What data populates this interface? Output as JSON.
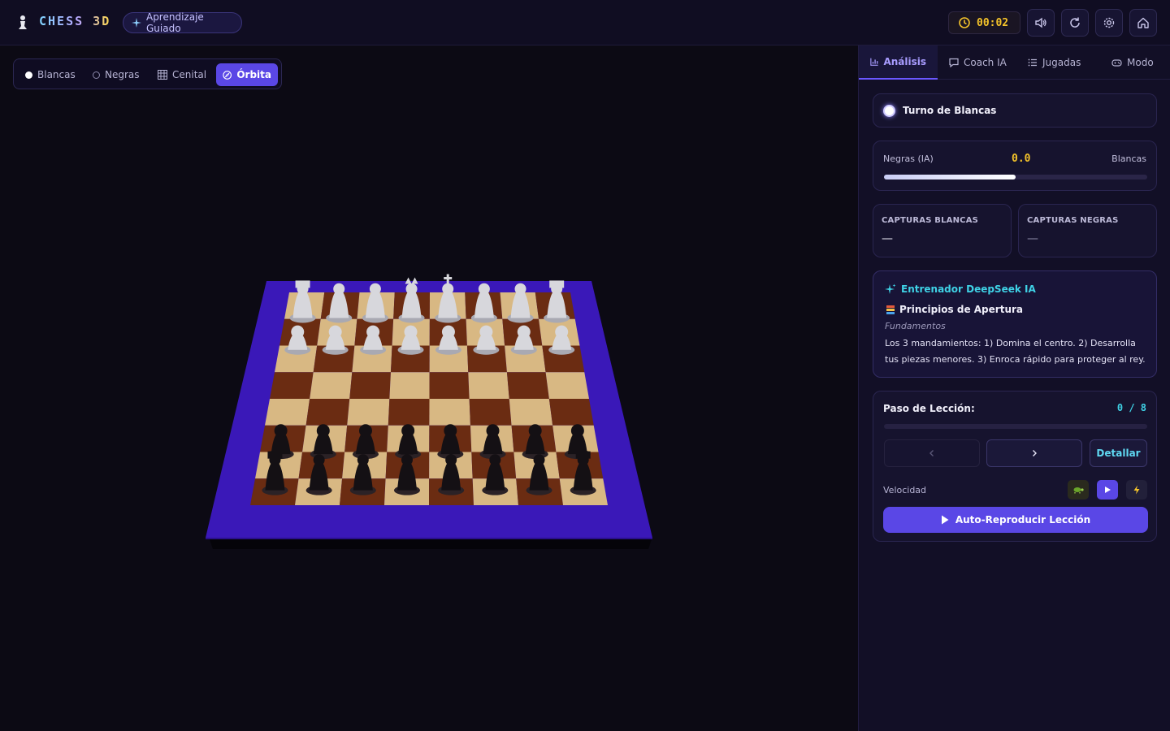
{
  "header": {
    "app_title": "CHESS 3D",
    "mode_badge": "Aprendizaje Guiado",
    "timer": "00:02",
    "icons": [
      "volume-icon",
      "refresh-icon",
      "settings-icon",
      "home-icon"
    ]
  },
  "camera": {
    "options": [
      {
        "label": "Blancas"
      },
      {
        "label": "Negras"
      },
      {
        "label": "Cenital"
      },
      {
        "label": "Órbita"
      }
    ],
    "selected": "Órbita"
  },
  "colors": {
    "accent": "#5a47e6",
    "timer": "#f5c42a",
    "board_border": "#3a18b8",
    "light_square": "#d8b883",
    "dark_square": "#6b2c12",
    "teal_title": "#3fd2e6"
  },
  "panel": {
    "tabs": [
      {
        "label": "Análisis",
        "icon": "bar-chart-icon"
      },
      {
        "label": "Coach IA",
        "icon": "chat-icon"
      },
      {
        "label": "Jugadas",
        "icon": "list-icon"
      },
      {
        "label": "Modo",
        "icon": "gamepad-icon"
      }
    ],
    "turn": "Turno de Blancas",
    "eval": {
      "left": "Negras (IA)",
      "value": "0.0",
      "right": "Blancas",
      "white_fraction": 0.5
    },
    "captures": {
      "white_title": "CAPTURAS BLANCAS",
      "white_value": "—",
      "black_title": "CAPTURAS NEGRAS",
      "black_value": "—"
    },
    "coach": {
      "title": "Entrenador DeepSeek IA",
      "lesson_title": "Principios de Apertura",
      "category": "Fundamentos",
      "text": "Los 3 mandamientos: 1) Domina el centro. 2) Desarrolla tus piezas menores. 3) Enroca rápido para proteger al rey."
    },
    "lesson": {
      "label": "Paso de Lección:",
      "step": "0 / 8",
      "progress": 0,
      "detail_button": "Detallar",
      "speed_label": "Velocidad",
      "autoplay": "Auto-Reproducir Lección"
    }
  }
}
